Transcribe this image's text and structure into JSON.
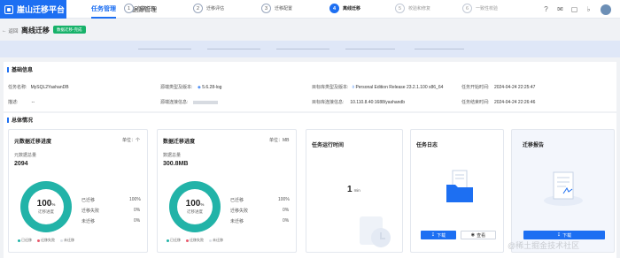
{
  "app": {
    "title": "崖山迁移平台"
  },
  "nav": [
    {
      "label": "任务管理"
    },
    {
      "label": "数据源管理"
    }
  ],
  "header": {
    "back_label": "返回",
    "page_title": "离线迁移",
    "status_badge": "数据迁移-完成"
  },
  "steps": [
    {
      "num": "1",
      "label": "创建任务"
    },
    {
      "num": "2",
      "label": "迁移评估"
    },
    {
      "num": "3",
      "label": "迁移配置"
    },
    {
      "num": "4",
      "label": "离线迁移"
    },
    {
      "num": "5",
      "label": "校验和修复"
    },
    {
      "num": "6",
      "label": "一致性校验"
    }
  ],
  "basic_info": {
    "title": "基础信息",
    "task_name_label": "任务名称:",
    "task_name": "MySQL2YashanDB",
    "desc_label": "描述:",
    "desc": "--",
    "src_type_label": "源端类型及版本:",
    "src_type": "5.6.28-log",
    "src_conn_label": "源端连接信息:",
    "src_conn": "",
    "tgt_type_label": "目标库类型及版本:",
    "tgt_type": "Personal Edition Release 23.2.1.100 x86_64",
    "tgt_conn_label": "目标库连接信息:",
    "tgt_conn": "10.110.8.40:1688/yashandb",
    "start_label": "任务开始时间:",
    "start": "2024-04-24 22:25:47",
    "end_label": "任务结束时间:",
    "end": "2024-04-24 22:26:46"
  },
  "overview": {
    "title": "总体情况"
  },
  "meta_card": {
    "title": "元数据迁移进度",
    "unit": "单位：个",
    "total_label": "元数据总量",
    "total": "2094",
    "percent": "100",
    "percent_unit": "%",
    "percent_label": "迁移进度",
    "stats": [
      {
        "label": "已迁移",
        "value": "100%"
      },
      {
        "label": "迁移失败",
        "value": "0%"
      },
      {
        "label": "未迁移",
        "value": "0%"
      }
    ],
    "legend": [
      "已迁移",
      "迁移失败",
      "未迁移"
    ]
  },
  "data_card": {
    "title": "数据迁移进度",
    "unit": "单位：MB",
    "total_label": "数据总量",
    "total": "300.8MB",
    "percent": "100",
    "percent_unit": "%",
    "percent_label": "迁移进度",
    "stats": [
      {
        "label": "已迁移",
        "value": "100%"
      },
      {
        "label": "迁移失败",
        "value": "0%"
      },
      {
        "label": "未迁移",
        "value": "0%"
      }
    ],
    "legend": [
      "已迁移",
      "迁移失败",
      "未迁移"
    ]
  },
  "runtime_card": {
    "title": "任务运行时间",
    "value": "1",
    "unit": "min"
  },
  "log_card": {
    "title": "任务日志",
    "download": "下载",
    "view": "查看"
  },
  "report_card": {
    "title": "迁移报告",
    "download": "下载"
  },
  "watermark": "@稀土掘金技术社区",
  "colors": {
    "accent": "#1d6ff2",
    "success": "#17b26a",
    "ring": "#22b3a8"
  }
}
